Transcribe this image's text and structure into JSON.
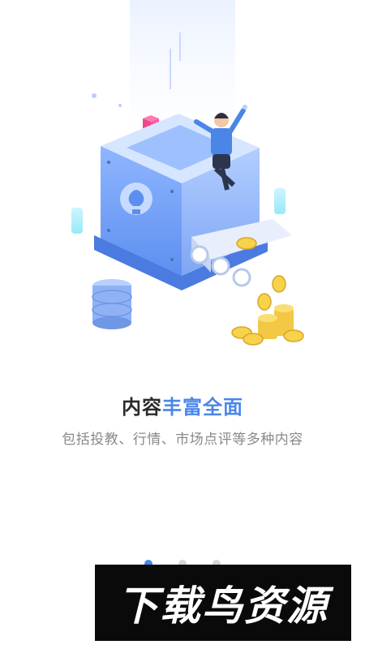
{
  "onboarding": {
    "title_prefix": "内容",
    "title_highlight": "丰富全面",
    "subtitle": "包括投教、行情、市场点评等多种内容",
    "page_indicator": {
      "total": 3,
      "active_index": 0
    }
  },
  "watermark": {
    "text": "下载鸟资源"
  },
  "colors": {
    "accent": "#4a86e8",
    "text": "#2b2b2b",
    "muted": "#8a8a8a",
    "dot_inactive": "#d6d6d6"
  }
}
